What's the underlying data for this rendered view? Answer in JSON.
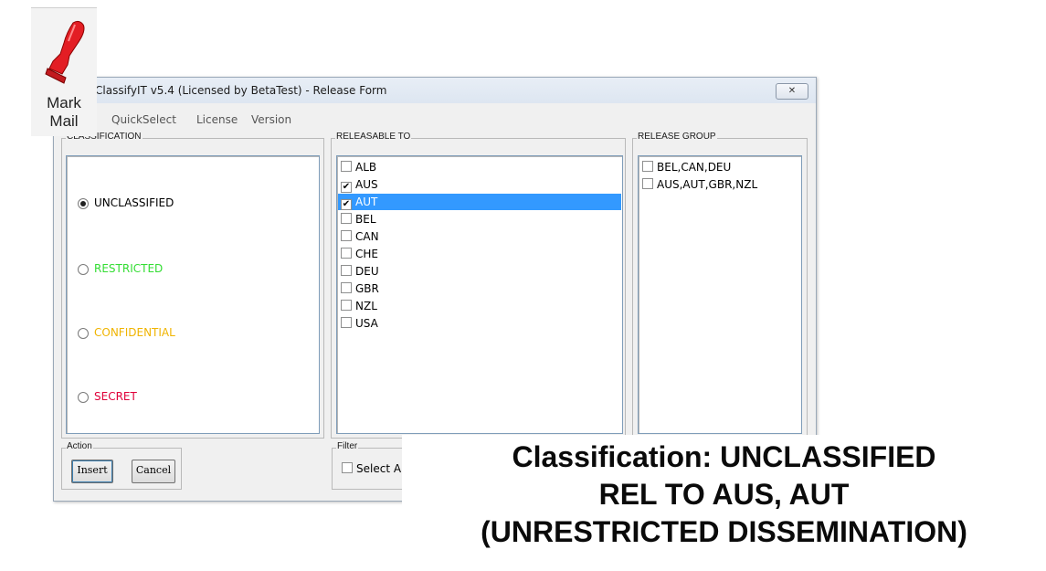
{
  "ribbon": {
    "line1": "Mark",
    "line2": "Mail",
    "icon": "rubber-stamp-icon"
  },
  "window": {
    "title": "ClassifyIT v5.4 (Licensed by BetaTest) - Release Form",
    "close_glyph": "✕"
  },
  "menu": [
    "QuickSelect",
    "License",
    "Version"
  ],
  "classification": {
    "label": "CLASSIFICATION",
    "options": [
      {
        "label": "UNCLASSIFIED",
        "color": "#000000",
        "selected": true
      },
      {
        "label": "RESTRICTED",
        "color": "#33dd33",
        "selected": false
      },
      {
        "label": "CONFIDENTIAL",
        "color": "#f0b400",
        "selected": false
      },
      {
        "label": "SECRET",
        "color": "#e0003a",
        "selected": false
      }
    ]
  },
  "releasable": {
    "label": "RELEASABLE TO",
    "items": [
      {
        "code": "ALB",
        "checked": false
      },
      {
        "code": "AUS",
        "checked": true
      },
      {
        "code": "AUT",
        "checked": true,
        "highlighted": true
      },
      {
        "code": "BEL",
        "checked": false
      },
      {
        "code": "CAN",
        "checked": false
      },
      {
        "code": "CHE",
        "checked": false
      },
      {
        "code": "DEU",
        "checked": false
      },
      {
        "code": "GBR",
        "checked": false
      },
      {
        "code": "NZL",
        "checked": false
      },
      {
        "code": "USA",
        "checked": false
      }
    ]
  },
  "release_group": {
    "label": "RELEASE GROUP",
    "items": [
      {
        "name": "BEL,CAN,DEU",
        "checked": false
      },
      {
        "name": "AUS,AUT,GBR,NZL",
        "checked": false
      }
    ]
  },
  "action": {
    "label": "Action",
    "insert": "Insert",
    "cancel": "Cancel"
  },
  "filter": {
    "label": "Filter",
    "select_partial": "Select A"
  },
  "banner": {
    "line1": "Classification: UNCLASSIFIED",
    "line2": "REL TO AUS, AUT",
    "line3": "(UNRESTRICTED DISSEMINATION)"
  }
}
